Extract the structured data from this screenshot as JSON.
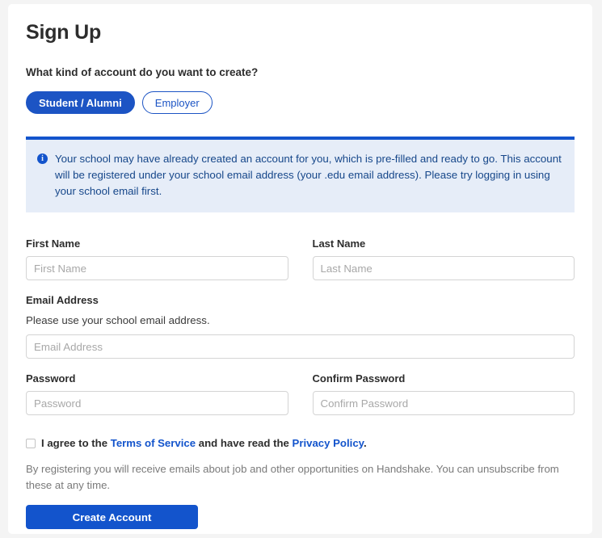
{
  "card": {
    "title": "Sign Up",
    "account_question": "What kind of account do you want to create?",
    "account_types": [
      {
        "label": "Student / Alumni",
        "selected": true
      },
      {
        "label": "Employer",
        "selected": false
      }
    ],
    "alert": {
      "icon": "info-icon",
      "icon_glyph": "i",
      "text": "Your school may have already created an account for you, which is pre-filled and ready to go. This account will be registered under your school email address (your .edu email address). Please try logging in using your school email first.",
      "accent_color": "#1354cc",
      "background_color": "#e6edf8",
      "text_color": "#16478a"
    },
    "fields": {
      "first_name": {
        "label": "First Name",
        "placeholder": "First Name",
        "value": ""
      },
      "last_name": {
        "label": "Last Name",
        "placeholder": "Last Name",
        "value": ""
      },
      "email": {
        "label": "Email Address",
        "help": "Please use your school email address.",
        "placeholder": "Email Address",
        "value": ""
      },
      "password": {
        "label": "Password",
        "placeholder": "Password",
        "value": ""
      },
      "confirm_password": {
        "label": "Confirm Password",
        "placeholder": "Confirm Password",
        "value": ""
      }
    },
    "agreement": {
      "checked": false,
      "prefix": "I agree to the",
      "terms_link": "Terms of Service",
      "middle": "and have read the",
      "privacy_link": "Privacy Policy",
      "suffix": "."
    },
    "disclaimer": "By registering you will receive emails about job and other opportunities on Handshake. You can unsubscribe from these at any time.",
    "submit_label": "Create Account",
    "accent_color": "#1354cc",
    "pill_selected_color": "#1c54c4",
    "page_background": "#f4f4f4"
  }
}
